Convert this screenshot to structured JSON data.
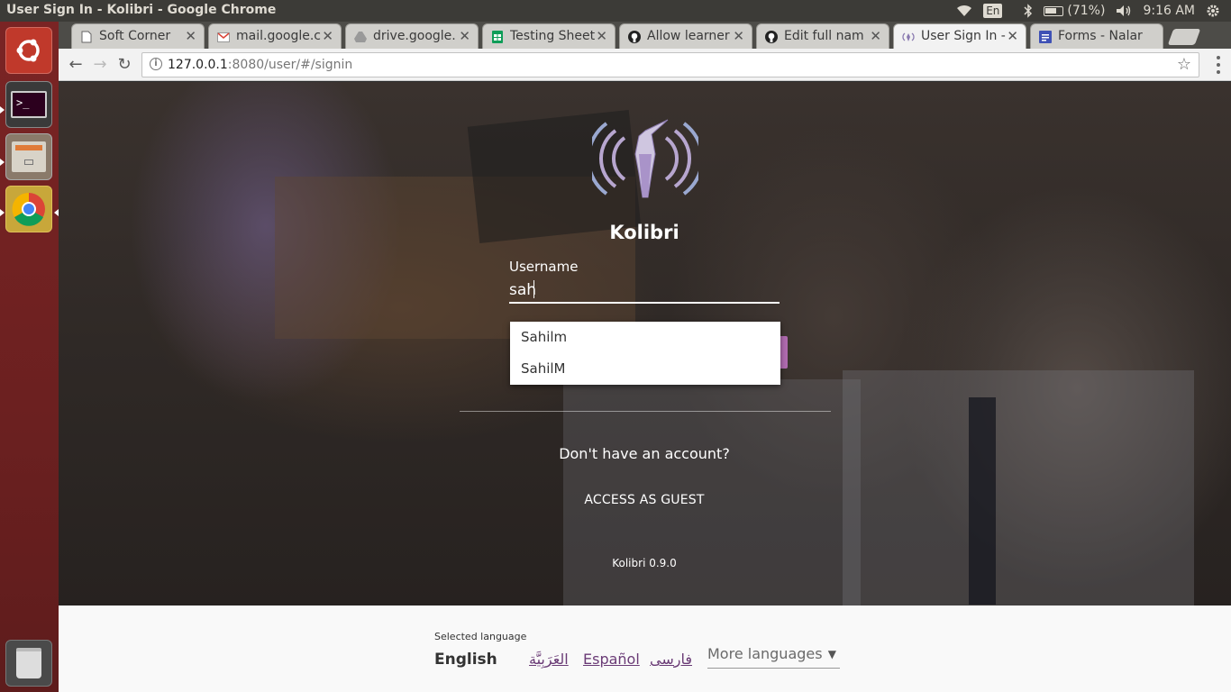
{
  "window": {
    "title": "User Sign In - Kolibri - Google Chrome"
  },
  "tray": {
    "keyboard": "En",
    "battery": "(71%)",
    "time": "9:16 AM"
  },
  "launcher": {
    "items": [
      {
        "name": "ubuntu-dash-icon"
      },
      {
        "name": "terminal-icon"
      },
      {
        "name": "files-icon"
      },
      {
        "name": "chrome-icon"
      },
      {
        "name": "trash-icon"
      }
    ]
  },
  "tabs": [
    {
      "label": "Soft Corner",
      "icon": "page-icon",
      "active": false
    },
    {
      "label": "mail.google.c",
      "icon": "gmail-icon",
      "active": false
    },
    {
      "label": "drive.google.",
      "icon": "drive-icon",
      "active": false
    },
    {
      "label": "Testing Sheet",
      "icon": "sheets-icon",
      "active": false
    },
    {
      "label": "Allow learner",
      "icon": "github-icon",
      "active": false
    },
    {
      "label": "Edit full nam",
      "icon": "github-icon",
      "active": false
    },
    {
      "label": "User Sign In -",
      "icon": "kolibri-icon",
      "active": true
    },
    {
      "label": "Forms - Nalar",
      "icon": "forms-icon",
      "active": false
    }
  ],
  "toolbar": {
    "url_host": "127.0.0.1",
    "url_path": ":8080/user/#/signin"
  },
  "signin": {
    "app_name": "Kolibri",
    "username_label": "Username",
    "username_value": "sah",
    "suggestions": [
      "Sahilm",
      "SahilM"
    ],
    "no_account": "Don't have an account?",
    "guest_link": "ACCESS AS GUEST",
    "version": "Kolibri 0.9.0"
  },
  "language": {
    "selected_label": "Selected language",
    "selected": "English",
    "options": [
      "العَرَبِيَّة",
      "Español",
      "فارسی"
    ],
    "more": "More languages"
  },
  "colors": {
    "launcher": "#7a2424",
    "topbar": "#3c3b37",
    "link": "#6a3b76",
    "signin_accent": "#b06bb0"
  }
}
